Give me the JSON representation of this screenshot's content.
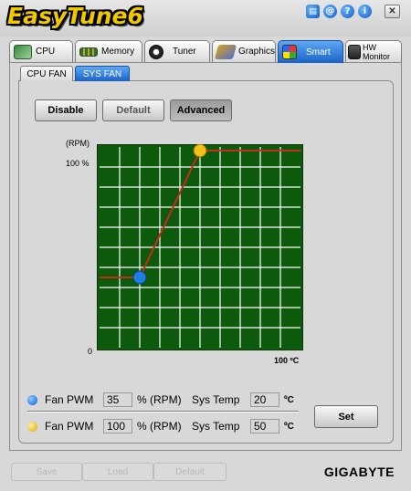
{
  "app": {
    "title": "EasyTune6",
    "brand": "GIGABYTE"
  },
  "titlebar_icons": [
    {
      "name": "doc-icon",
      "glyph": "▤"
    },
    {
      "name": "at-icon",
      "glyph": "@"
    },
    {
      "name": "help-icon",
      "glyph": "?"
    },
    {
      "name": "info-icon",
      "glyph": "i"
    }
  ],
  "close_glyph": "✕",
  "main_tabs": [
    {
      "label": "CPU",
      "icon": "cpu-icon",
      "active": false
    },
    {
      "label": "Memory",
      "icon": "memory-icon",
      "active": false
    },
    {
      "label": "Tuner",
      "icon": "tuner-icon",
      "active": false
    },
    {
      "label": "Graphics",
      "icon": "graphics-icon",
      "active": false
    },
    {
      "label": "Smart",
      "icon": "smart-icon",
      "active": true
    },
    {
      "label": "HW Monitor",
      "icon": "hw-monitor-icon",
      "active": false
    }
  ],
  "sub_tabs": [
    {
      "label": "CPU FAN",
      "active": false
    },
    {
      "label": "SYS FAN",
      "active": true
    }
  ],
  "mode_buttons": {
    "disable": "Disable",
    "default": "Default",
    "advanced": "Advanced",
    "selected": "advanced"
  },
  "graph": {
    "y_unit": "(RPM)",
    "y_max_label": "100 %",
    "origin_label": "0",
    "x_max_label": "100 ºC",
    "colors": {
      "bg": "#0d5a0d",
      "grid": "#ffffff",
      "line": "#c62b1c",
      "low_point": "#1f7de0",
      "high_point": "#f2c21a"
    },
    "curve": [
      {
        "temp": 0,
        "pwm": 35
      },
      {
        "temp": 20,
        "pwm": 35
      },
      {
        "temp": 50,
        "pwm": 100
      },
      {
        "temp": 100,
        "pwm": 100
      }
    ]
  },
  "fan_rows": [
    {
      "dot": "blue",
      "label": "Fan PWM",
      "pwm": "35",
      "pwm_unit": "% (RPM)",
      "temp_label": "Sys Temp",
      "temp": "20",
      "temp_unit": "ºC"
    },
    {
      "dot": "yellow",
      "label": "Fan PWM",
      "pwm": "100",
      "pwm_unit": "% (RPM)",
      "temp_label": "Sys Temp",
      "temp": "50",
      "temp_unit": "ºC"
    }
  ],
  "set_button": "Set",
  "bottom_buttons": [
    "Save",
    "Load",
    "Default"
  ]
}
